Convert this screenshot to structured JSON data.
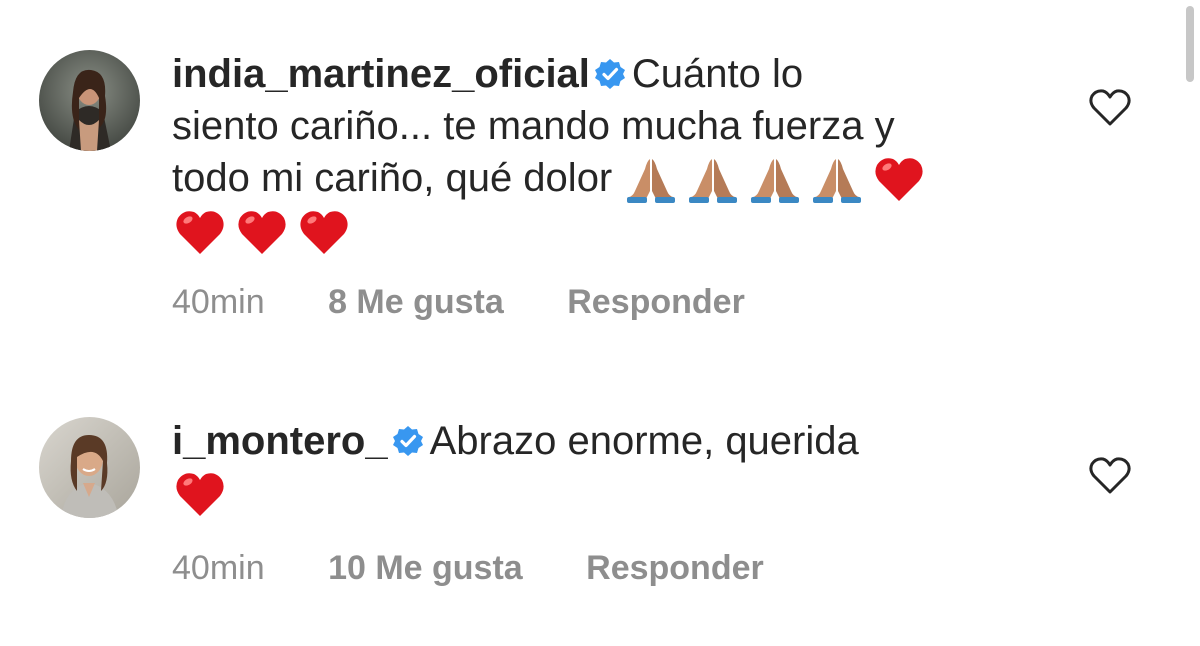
{
  "comments": [
    {
      "username": "india_martinez_oficial",
      "verified": true,
      "text_line1": "Cuánto lo",
      "text_line2": "siento cariño... te mando mucha fuerza y",
      "text_line3": "todo mi cariño, qué dolor",
      "emoji_line3": [
        "folded-hands",
        "folded-hands",
        "folded-hands",
        "folded-hands",
        "red-heart"
      ],
      "emoji_line4": [
        "red-heart",
        "red-heart",
        "red-heart"
      ],
      "time": "40min",
      "likes": "8 Me gusta",
      "reply": "Responder"
    },
    {
      "username": "i_montero_",
      "verified": true,
      "text_line1": "Abrazo enorme, querida",
      "emoji_line2": [
        "red-heart"
      ],
      "time": "40min",
      "likes": "10 Me gusta",
      "reply": "Responder"
    }
  ],
  "colors": {
    "text": "#262626",
    "meta": "#8e8e8e",
    "verified_badge": "#3897f0",
    "heart_emoji": "#e0141e"
  },
  "icons": {
    "like": "heart-outline-icon",
    "verified": "verified-badge-icon"
  }
}
